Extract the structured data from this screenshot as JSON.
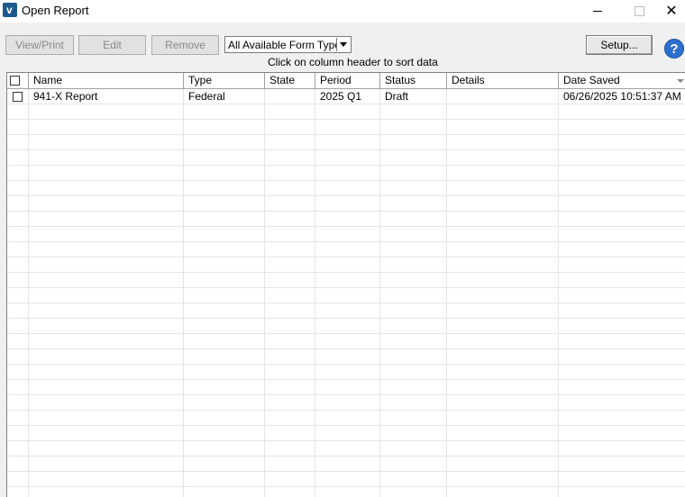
{
  "window": {
    "title": "Open Report",
    "minimize_glyph": "",
    "close_glyph": "✕"
  },
  "toolbar": {
    "view_print_label": "View/Print",
    "edit_label": "Edit",
    "remove_label": "Remove",
    "form_type_selected": "All Available Form Types",
    "setup_label": "Setup...",
    "help_glyph": "?",
    "hint": "Click on column header to sort data"
  },
  "table": {
    "columns": [
      "Name",
      "Type",
      "State",
      "Period",
      "Status",
      "Details",
      "Date Saved"
    ],
    "rows": [
      {
        "checked": false,
        "name": "941-X Report",
        "type": "Federal",
        "state": "",
        "period": "2025 Q1",
        "status": "Draft",
        "details": "",
        "date_saved": "06/26/2025 10:51:37 AM"
      }
    ]
  },
  "icons": {
    "app": "app-logo-icon",
    "help": "help-icon",
    "sort": "sort-down-icon"
  }
}
